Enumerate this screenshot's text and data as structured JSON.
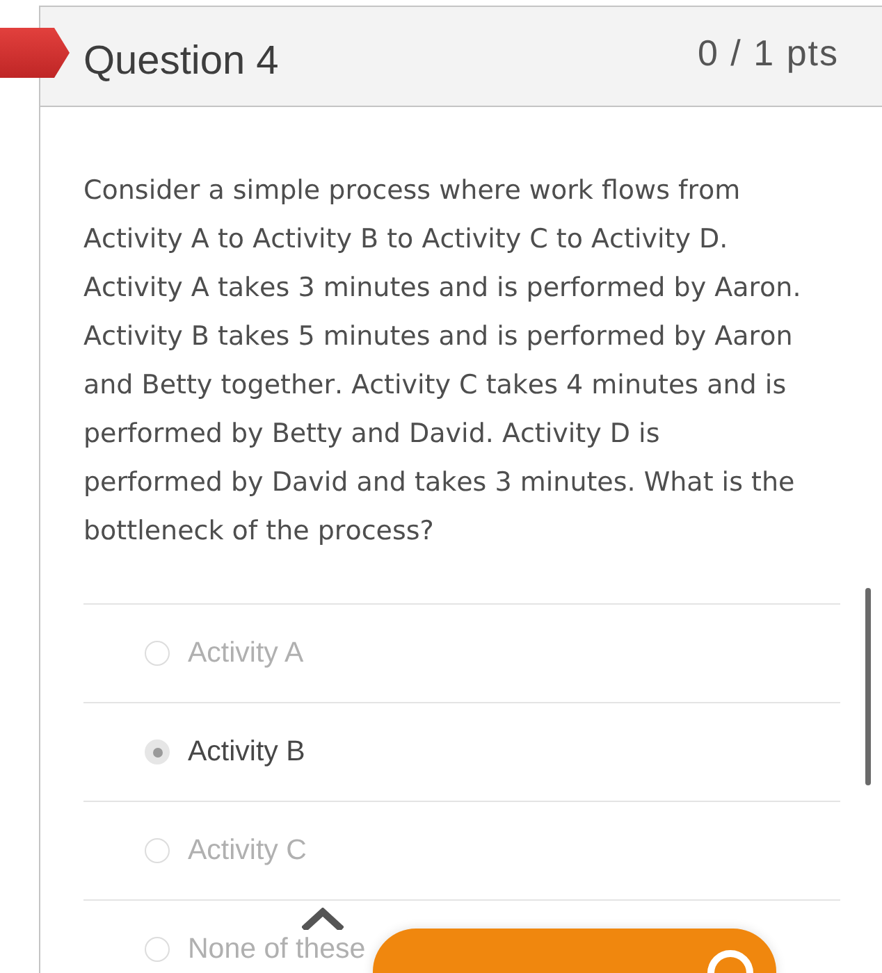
{
  "question": {
    "title": "Question 4",
    "points": "0 / 1 pts",
    "flagged": true
  },
  "prompt": "Consider a simple process where work flows from Activity A to Activity B to Activity C to Activity D. Activity A takes 3 minutes and is performed by Aaron. Activity B takes 5 minutes and is performed by Aaron and Betty together. Activity C takes 4 minutes and is performed by Betty and David. Activity D is performed by David and takes 3 minutes. What is the bottleneck of the process?",
  "answers": [
    {
      "label": "Activity A",
      "selected": false
    },
    {
      "label": "Activity B",
      "selected": true
    },
    {
      "label": "Activity C",
      "selected": false
    },
    {
      "label": "None of these",
      "selected": false
    }
  ]
}
